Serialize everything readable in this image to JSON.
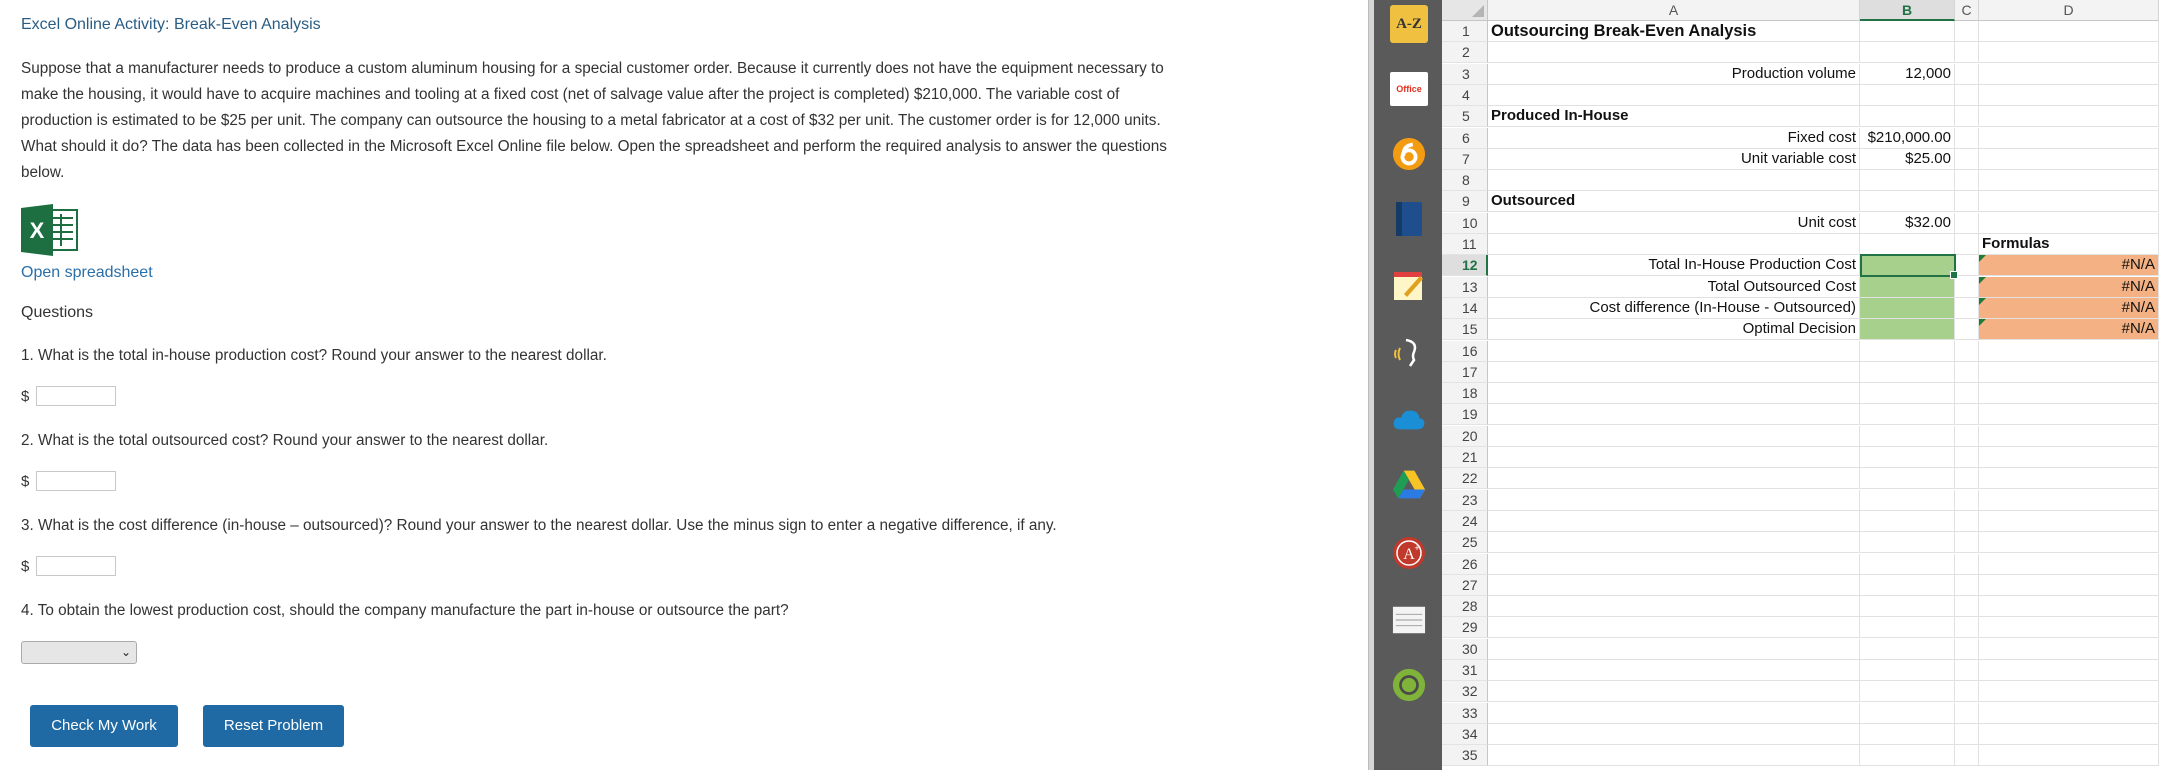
{
  "activity": {
    "title": "Excel Online Activity: Break-Even Analysis",
    "paragraph_lines": [
      "Suppose that a manufacturer needs to produce a custom aluminum housing for a special customer order. Because it currently does not have the equipment necessary to",
      "make the housing, it would have to acquire machines and tooling at a fixed cost (net of salvage value after the project is completed) $210,000. The variable cost of",
      "production is estimated to be $25 per unit. The company can outsource the housing to a metal fabricator at a cost of $32 per unit. The customer order is for 12,000 units.",
      "What should it do? The data has been collected in the Microsoft Excel Online file below. Open the spreadsheet and perform the required analysis to answer the questions",
      "below."
    ],
    "open_spreadsheet_label": "Open spreadsheet",
    "questions_heading": "Questions",
    "questions": [
      "1. What is the total in-house production cost? Round your answer to the nearest dollar.",
      "2. What is the total outsourced cost? Round your answer to the nearest dollar.",
      "3. What is the cost difference (in-house – outsourced)? Round your answer to the nearest dollar. Use the minus sign to enter a negative difference, if any.",
      "4. To obtain the lowest production cost, should the company manufacture the part in-house or outsource the part?"
    ],
    "currency_symbol": "$",
    "answers": [
      "",
      "",
      ""
    ],
    "decision_select_value": "",
    "check_button": "Check My Work",
    "reset_button": "Reset Problem"
  },
  "toolbar": {
    "az_label": "A-Z",
    "office_label": "Office",
    "icons": [
      "az-dictionary-icon",
      "office-icon",
      "six-circle-icon",
      "book-icon",
      "notepad-icon",
      "read-aloud-icon",
      "cloud-icon",
      "drive-icon",
      "grade-a-plus-icon",
      "notes-icon",
      "profile-circle-icon"
    ]
  },
  "sheet": {
    "columns": [
      "A",
      "B",
      "C",
      "D"
    ],
    "selected_column": "B",
    "selected_row": 12,
    "row_count": 35,
    "cells": {
      "A1": "Outsourcing Break-Even Analysis",
      "A3": "Production volume",
      "B3": "12,000",
      "A5": "Produced In-House",
      "A6": "Fixed cost",
      "B6": "$210,000.00",
      "A7": "Unit variable cost",
      "B7": "$25.00",
      "A9": "Outsourced",
      "A10": "Unit cost",
      "B10": "$32.00",
      "D11": "Formulas",
      "A12": "Total In-House Production Cost",
      "A13": "Total Outsourced Cost",
      "A14": "Cost difference (In-House - Outsourced)",
      "A15": "Optimal Decision",
      "D12": "#N/A",
      "D13": "#N/A",
      "D14": "#N/A",
      "D15": "#N/A"
    }
  }
}
